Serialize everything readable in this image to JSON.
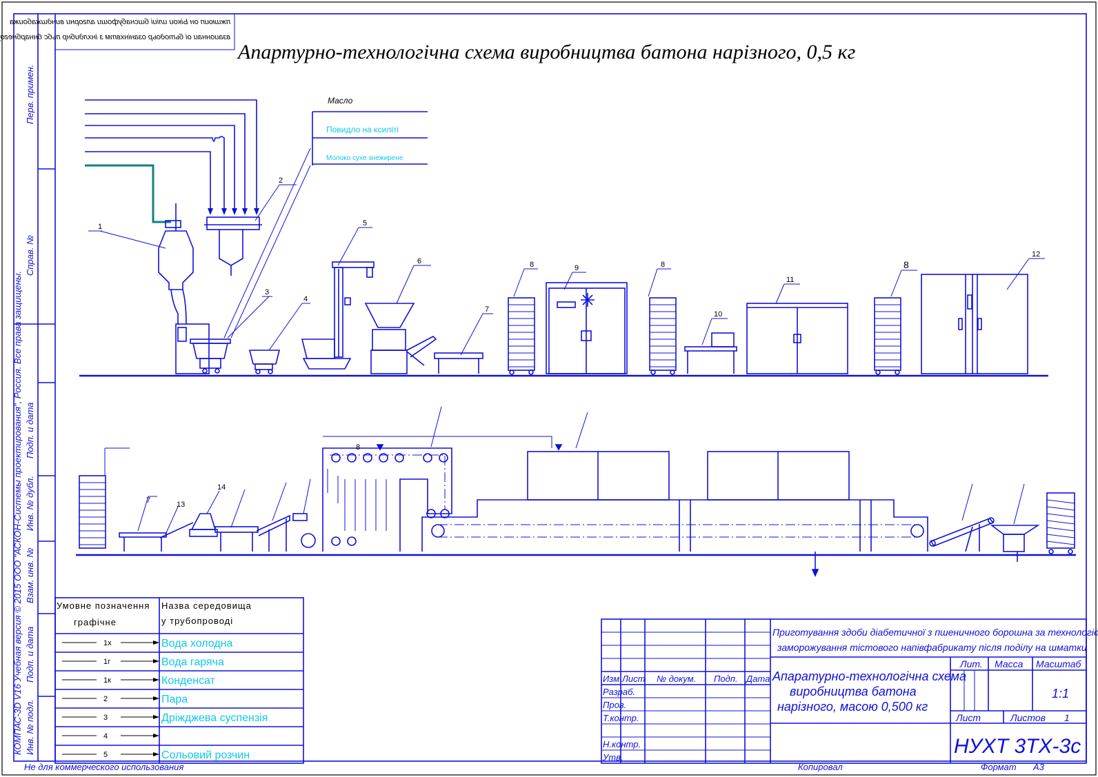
{
  "title": "Апартурно-технологічна схема виробництва батона нарізного, 0,5 кг",
  "mirrored_stamp": [
    "пжшюип он Ьікои иліиі бшснабуфоши алгорни виндшжабоижа",
    "взаионнаи оі бьтодоьр озанінхвтм з інхлдибнр пьбс бннарбнегоу"
  ],
  "side_labels": {
    "perv_primen": "Перв. примен.",
    "sprav_no": "Справ. №",
    "podp_data_1": "Подп. и дата",
    "inv_dubl": "Инв. № дубл.",
    "vzam_inv": "Взам. инв. №",
    "podp_data_2": "Подп. и дата",
    "inv_podl": "Инв. № подл.",
    "copyright": "КОМПАС-3D V16 Учебная версия  © 2015 ООО \"АСКОН-Системы проектирования\", Россия. Все права защищены."
  },
  "inputs": {
    "maslo": "Масло",
    "povidlo": "Повидло на ксиліті",
    "moloko": "Молоко сухе знежирене"
  },
  "equipment_numbers_top": [
    "1",
    "2",
    "3",
    "4",
    "5",
    "6",
    "7",
    "8",
    "9",
    "8",
    "10",
    "11",
    "8",
    "12"
  ],
  "equipment_numbers_bottom": [
    "7",
    "13",
    "14",
    "8"
  ],
  "legend": {
    "header_left_1": "Умовне позначення",
    "header_left_2": "графічне",
    "header_right_1": "Назва середовища",
    "header_right_2": "у трубопроводі",
    "rows": [
      {
        "code": "1х",
        "name": "Вода холодна"
      },
      {
        "code": "1г",
        "name": "Вода гаряча"
      },
      {
        "code": "1к",
        "name": "Конденсат"
      },
      {
        "code": "2",
        "name": "Пара"
      },
      {
        "code": "3",
        "name": "Дріжджева суспензія"
      },
      {
        "code": "4",
        "name": ""
      },
      {
        "code": "5",
        "name": "Сольовий розчин"
      }
    ]
  },
  "stamp": {
    "project_title_1": "Приготування здоби діабетичної з пшеничного борошна за технологією",
    "project_title_2": "заморожування тістового напівфабрикату після поділу на шматки",
    "drawing_title_1": "Апаратурно-технологічна схема",
    "drawing_title_2": "виробництва батона",
    "drawing_title_3": "нарізного, масою 0,500 кг",
    "izm": "Изм.",
    "list": "Лист",
    "dokum": "№ докум.",
    "podp": "Подп.",
    "data": "Дата",
    "razrab": "Разраб.",
    "prov": "Пров.",
    "tkontr": "Т.контр.",
    "nkontr": "Н.контр.",
    "utv": "Утв.",
    "lit": "Лит.",
    "massa": "Масса",
    "masshtab": "Масштаб",
    "scale": "1:1",
    "list2": "Лист",
    "listov": "Листов",
    "listov_val": "1",
    "code": "НУХТ 3ТХ-3с"
  },
  "footer": {
    "noncommercial": "Не для коммерческого использования",
    "kopiroval": "Копировал",
    "format": "Формат",
    "format_val": "А3"
  },
  "colors": {
    "line": "#1010d8",
    "cyan_text": "#10c8e8",
    "teal_pipe": "#108080"
  }
}
